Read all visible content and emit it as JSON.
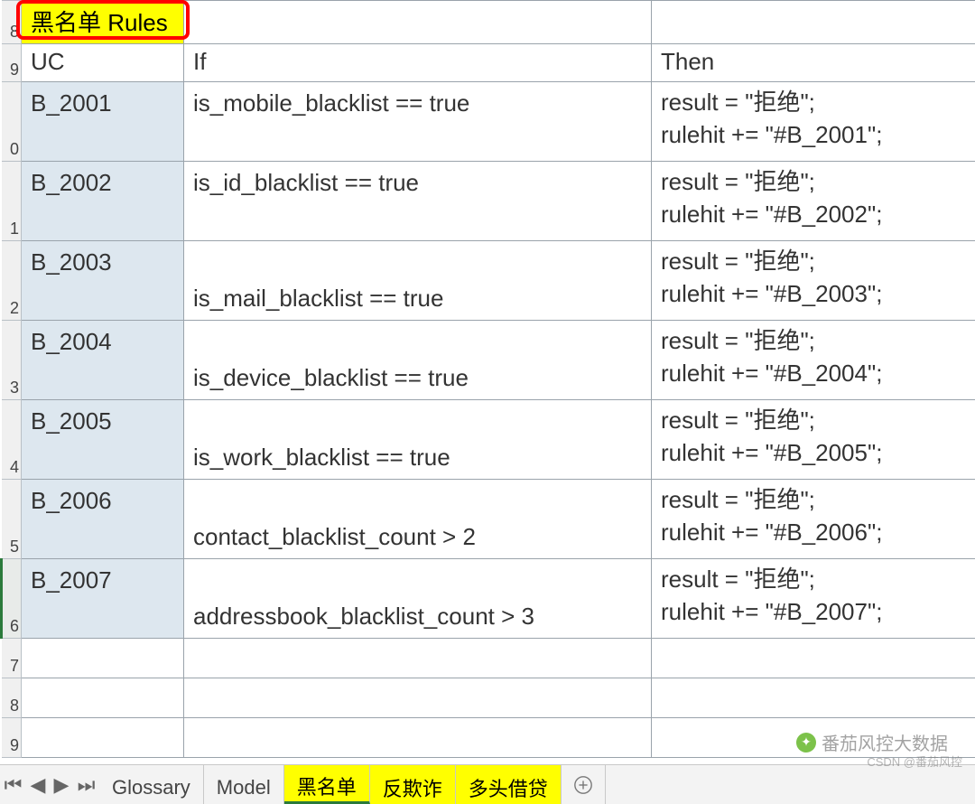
{
  "row_numbers": [
    "8",
    "9",
    "0",
    "1",
    "2",
    "3",
    "4",
    "5",
    "6",
    "7",
    "8",
    "9"
  ],
  "title": "黑名单 Rules",
  "headers": {
    "uc": "UC",
    "if": "If",
    "then": "Then"
  },
  "rules": [
    {
      "uc": "B_2001",
      "if": "is_mobile_blacklist == true",
      "then1": "result = \"拒绝\";",
      "then2": "rulehit += \"#B_2001\";"
    },
    {
      "uc": "B_2002",
      "if": "is_id_blacklist == true",
      "then1": "result = \"拒绝\";",
      "then2": "rulehit += \"#B_2002\";"
    },
    {
      "uc": "B_2003",
      "if": "is_mail_blacklist == true",
      "then1": "result = \"拒绝\";",
      "then2": "rulehit += \"#B_2003\";"
    },
    {
      "uc": "B_2004",
      "if": "is_device_blacklist == true",
      "then1": "result = \"拒绝\";",
      "then2": "rulehit += \"#B_2004\";"
    },
    {
      "uc": "B_2005",
      "if": "is_work_blacklist == true",
      "then1": "result = \"拒绝\";",
      "then2": "rulehit += \"#B_2005\";"
    },
    {
      "uc": "B_2006",
      "if": "contact_blacklist_count > 2",
      "then1": "result = \"拒绝\";",
      "then2": "rulehit += \"#B_2006\";"
    },
    {
      "uc": "B_2007",
      "if": "addressbook_blacklist_count > 3",
      "then1": "result = \"拒绝\";",
      "then2": "rulehit += \"#B_2007\";"
    }
  ],
  "tabs": {
    "nav": {
      "first": "⏮",
      "prev": "◀",
      "next": "▶",
      "last": "⏭"
    },
    "items": [
      {
        "label": "Glossary",
        "highlight": false
      },
      {
        "label": "Model",
        "highlight": false
      },
      {
        "label": "黑名单",
        "highlight": true,
        "active": true
      },
      {
        "label": "反欺诈",
        "highlight": true
      },
      {
        "label": "多头借贷",
        "highlight": true
      }
    ]
  },
  "watermark1": "番茄风控大数据",
  "watermark2": "CSDN @番茄风控"
}
